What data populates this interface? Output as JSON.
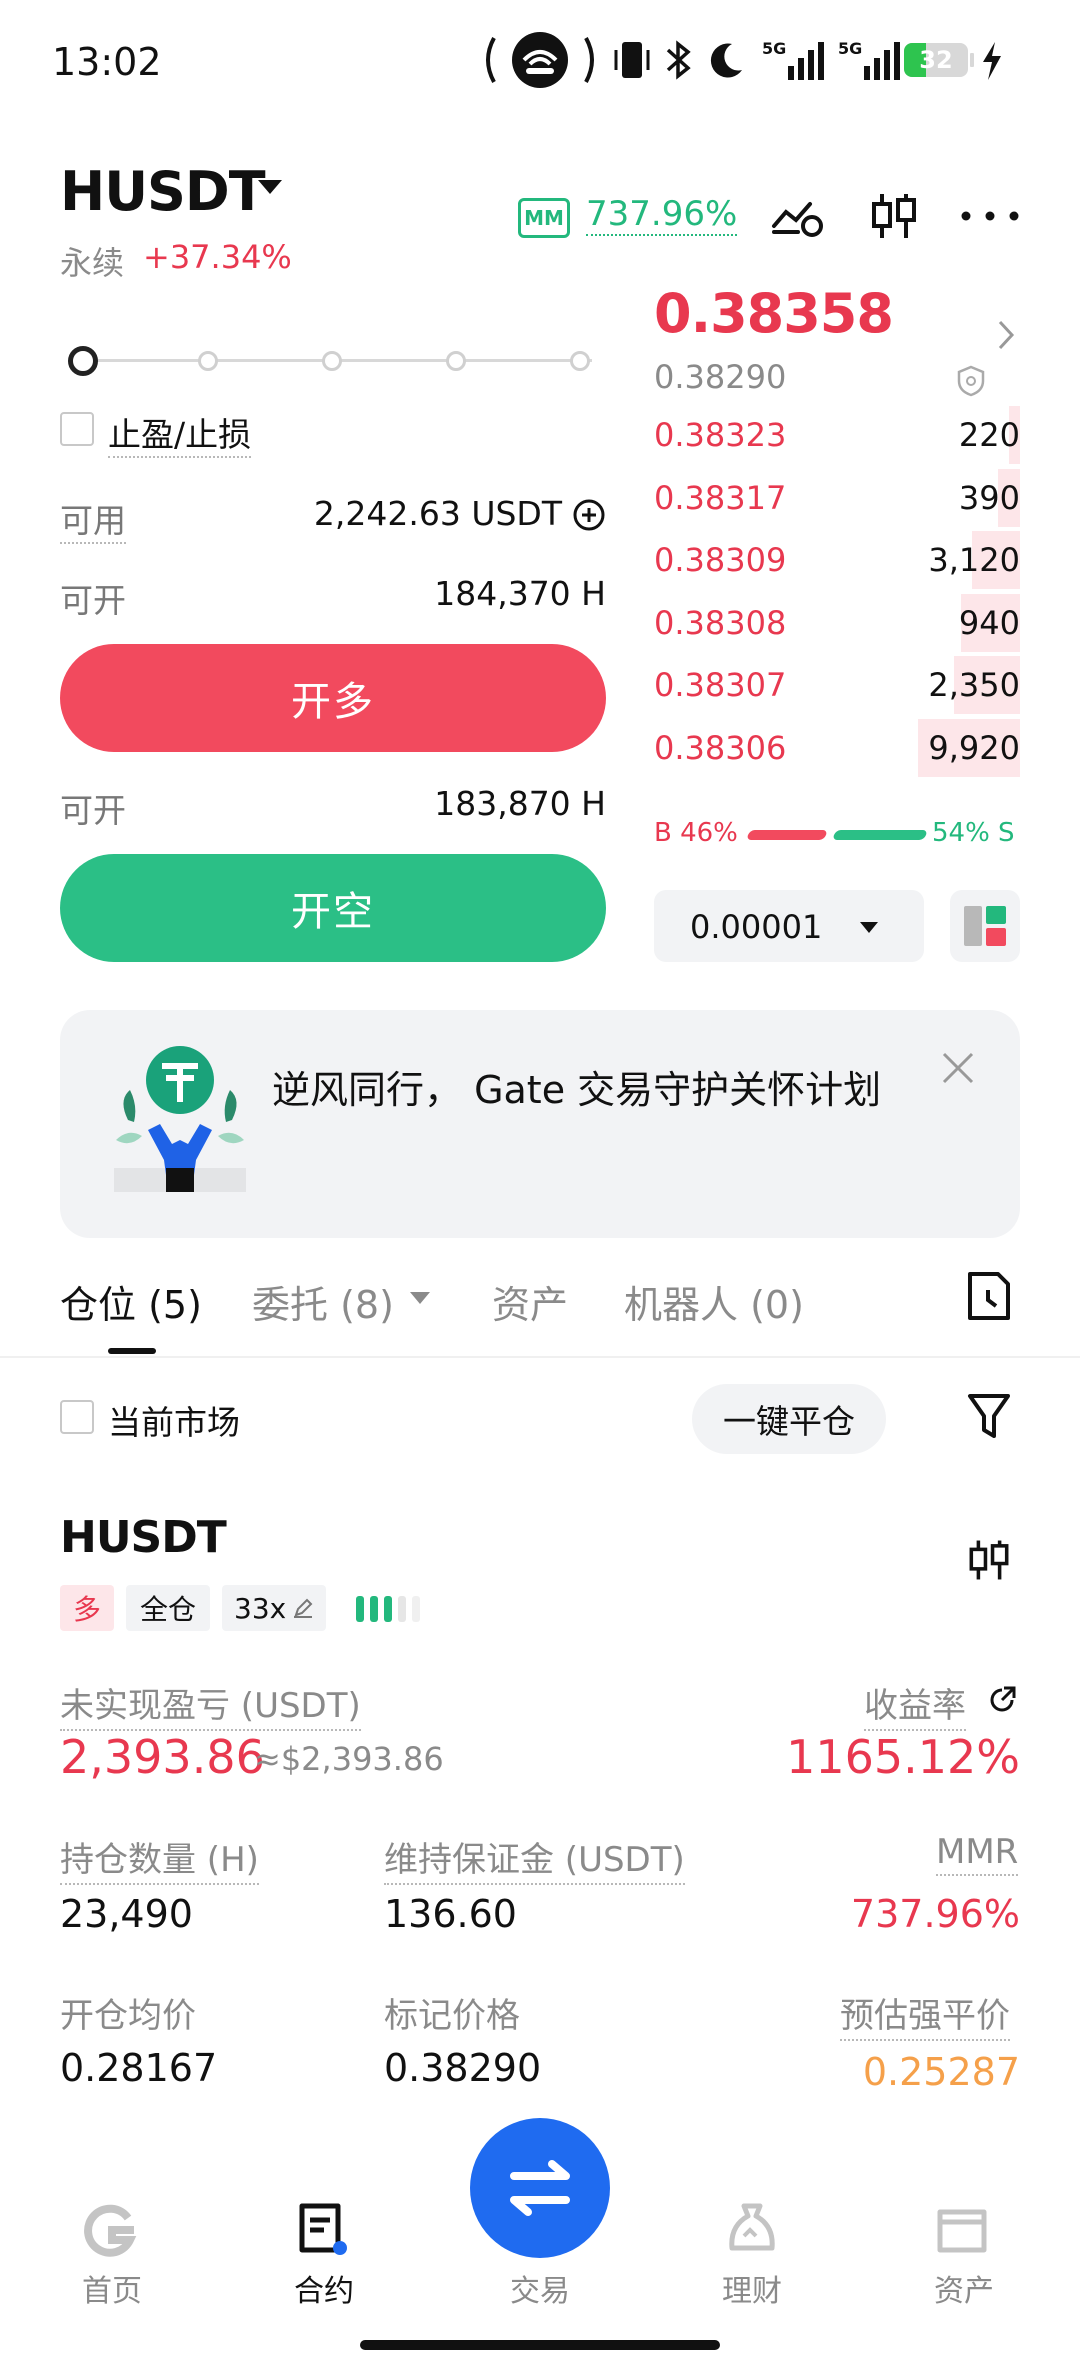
{
  "status_bar": {
    "time": "13:02",
    "battery": "32",
    "network_labels": [
      "5G",
      "5G"
    ],
    "icons": [
      "hotspot-icon",
      "vibrate-icon",
      "bluetooth-icon",
      "moon-icon",
      "signal-icon",
      "signal-icon",
      "battery-icon",
      "charging-icon"
    ]
  },
  "header": {
    "pair": "HUSDT",
    "contract_type": "永续",
    "change_pct": "+37.34%",
    "mm_badge": "MM",
    "mm_value": "737.96%"
  },
  "order_form": {
    "leverage_slider_level": 0,
    "tp_sl_label": "止盈/止损",
    "available_label": "可用",
    "available_value": "2,242.63 USDT",
    "open_long_label": "可开",
    "open_long_value": "184,370 H",
    "long_button": "开多",
    "open_short_label": "可开",
    "open_short_value": "183,870 H",
    "short_button": "开空"
  },
  "order_book": {
    "last_price": "0.38358",
    "mark_price": "0.38290",
    "asks": [
      {
        "price": "0.38323",
        "qty": "220",
        "depth": 0.03
      },
      {
        "price": "0.38317",
        "qty": "390",
        "depth": 0.06
      },
      {
        "price": "0.38309",
        "qty": "3,120",
        "depth": 0.13
      },
      {
        "price": "0.38308",
        "qty": "940",
        "depth": 0.16
      },
      {
        "price": "0.38307",
        "qty": "2,350",
        "depth": 0.18
      },
      {
        "price": "0.38306",
        "qty": "9,920",
        "depth": 0.28
      }
    ],
    "buy_ratio_label": "B 46%",
    "sell_ratio_label": "54% S",
    "buy_ratio": 0.46,
    "precision": "0.00001"
  },
  "banner": {
    "text": "逆风同行， Gate 交易守护关怀计划"
  },
  "tabs": [
    {
      "label": "仓位 (5)",
      "active": true
    },
    {
      "label": "委托 (8)",
      "active": false
    },
    {
      "label": "资产",
      "active": false
    },
    {
      "label": "机器人 (0)",
      "active": false
    }
  ],
  "filter": {
    "current_market_label": "当前市场",
    "close_all_label": "一键平仓"
  },
  "position": {
    "pair": "HUSDT",
    "side_tag": "多",
    "margin_tag": "全仓",
    "leverage_tag": "33x",
    "unrealized_label": "未实现盈亏 (USDT)",
    "unrealized_value": "2,393.86",
    "unrealized_usd": "≈$2,393.86",
    "roe_label": "收益率",
    "roe_value": "1165.12%",
    "size_label": "持仓数量 (H)",
    "size_value": "23,490",
    "maint_margin_label": "维持保证金 (USDT)",
    "maint_margin_value": "136.60",
    "mmr_label": "MMR",
    "mmr_value": "737.96%",
    "entry_label": "开仓均价",
    "entry_value": "0.28167",
    "mark_label": "标记价格",
    "mark_value": "0.38290",
    "liq_label": "预估强平价",
    "liq_value": "0.25287"
  },
  "bottom_nav": [
    {
      "label": "首页",
      "icon": "home-icon"
    },
    {
      "label": "合约",
      "icon": "contract-icon"
    },
    {
      "label": "交易",
      "icon": "swap-icon"
    },
    {
      "label": "理财",
      "icon": "finance-icon"
    },
    {
      "label": "资产",
      "icon": "wallet-icon"
    }
  ],
  "colors": {
    "red": "#e8384f",
    "green": "#23b87d",
    "orange": "#f5a04a",
    "blue": "#1f6bf0"
  }
}
